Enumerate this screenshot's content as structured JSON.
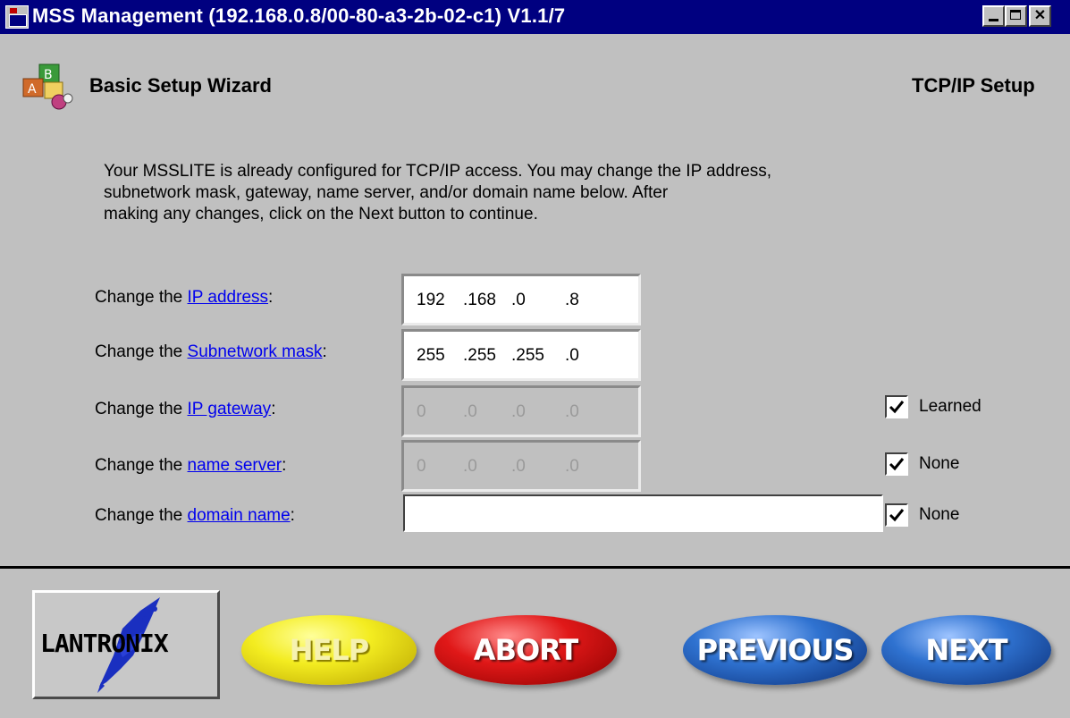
{
  "window": {
    "title": "MSS Management (192.168.0.8/00-80-a3-2b-02-c1) V1.1/7",
    "controls": [
      "minimize",
      "maximize",
      "close"
    ]
  },
  "header": {
    "wizard_title": "Basic Setup Wizard",
    "step_title": "TCP/IP Setup",
    "icon": "blocks-icon"
  },
  "intro": {
    "line1": "Your MSSLITE is already configured for TCP/IP access. You may change the IP address,",
    "line2": "subnetwork mask, gateway, name server, and/or domain name below. After",
    "line3": "making any changes, click on the Next button to continue."
  },
  "fields": {
    "ip_address": {
      "prefix": "Change the ",
      "link": "IP address",
      "suffix": ":",
      "octets": [
        "192",
        ".168",
        ".0",
        ".8"
      ],
      "enabled": true
    },
    "subnet_mask": {
      "prefix": "Change the ",
      "link": "Subnetwork mask",
      "suffix": ":",
      "octets": [
        "255",
        ".255",
        ".255",
        ".0"
      ],
      "enabled": true
    },
    "ip_gateway": {
      "prefix": "Change the ",
      "link": "IP gateway",
      "suffix": ":",
      "octets": [
        "0",
        ".0",
        ".0",
        ".0"
      ],
      "enabled": false,
      "checkbox_label": "Learned",
      "checked": true
    },
    "name_server": {
      "prefix": "Change the ",
      "link": "name server",
      "suffix": ":",
      "octets": [
        "0",
        ".0",
        ".0",
        ".0"
      ],
      "enabled": false,
      "checkbox_label": "None",
      "checked": true
    },
    "domain_name": {
      "prefix": "Change the ",
      "link": "domain name",
      "suffix": ":",
      "value": "",
      "checkbox_label": "None",
      "checked": true
    }
  },
  "footer": {
    "logo_text": "LANTRONIX",
    "help_label": "HELP",
    "abort_label": "ABORT",
    "previous_label": "PREVIOUS",
    "next_label": "NEXT"
  },
  "colors": {
    "titlebar": "#000080",
    "background": "#c0c0c0",
    "link": "#0000ee",
    "help": "#f3ec20",
    "abort": "#e01818",
    "previous": "#2f72d0",
    "next": "#2f72d0"
  }
}
